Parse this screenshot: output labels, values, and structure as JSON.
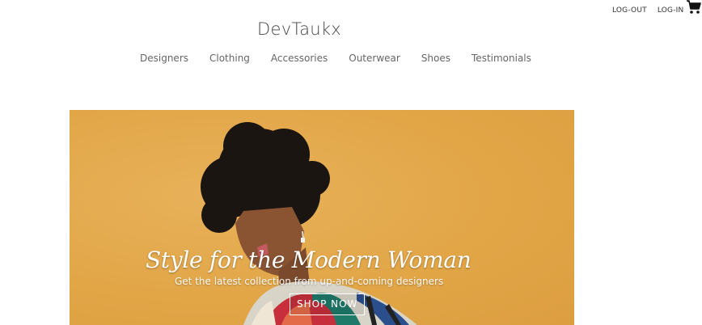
{
  "header": {
    "brand": "DevTaukx",
    "account": {
      "logout_label": "LOG-OUT",
      "login_label": "LOG-IN"
    },
    "cart_icon": "shopping-cart-icon"
  },
  "nav": {
    "items": [
      {
        "label": "Designers"
      },
      {
        "label": "Clothing"
      },
      {
        "label": "Accessories"
      },
      {
        "label": "Outerwear"
      },
      {
        "label": "Shoes"
      },
      {
        "label": "Testimonials"
      }
    ]
  },
  "hero": {
    "headline": "Style for the Modern Woman",
    "subheadline": "Get the latest collection from up-and-coming designers",
    "cta_label": "SHOP NOW",
    "background_color": "#e2a647"
  }
}
